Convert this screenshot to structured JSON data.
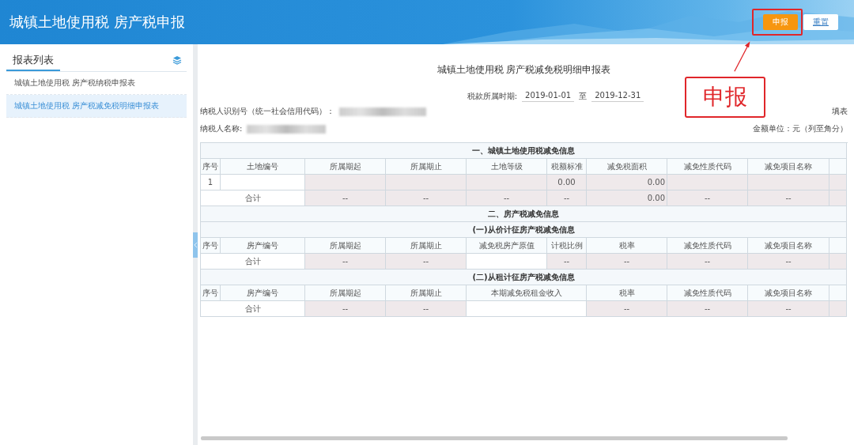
{
  "header": {
    "title": "城镇土地使用税 房产税申报",
    "buttons": [
      {
        "label": "申报",
        "kind": "primary"
      },
      {
        "label": "重置",
        "kind": "secondary"
      }
    ]
  },
  "callout": {
    "label": "申报"
  },
  "sidebar": {
    "title": "报表列表",
    "items": [
      {
        "label": "城镇土地使用税 房产税纳税申报表",
        "selected": false
      },
      {
        "label": "城镇土地使用税 房产税减免税明细申报表",
        "selected": true
      }
    ]
  },
  "form": {
    "title": "城镇土地使用税 房产税减免税明细申报表",
    "period": {
      "label": "税款所属时期:",
      "from": "2019-01-01",
      "separator": "至",
      "to": "2019-12-31"
    },
    "taxpayer_id": {
      "label": "纳税人识别号（统一社会信用代码）：",
      "redacted": true
    },
    "taxpayer_name": {
      "label": "纳税人名称:",
      "redacted": true
    },
    "fill_label": "填表",
    "unit": "金额单位：元（列至角分）",
    "rows": [
      {
        "kind": "section",
        "text": "一、城镇土地使用税减免信息"
      },
      {
        "kind": "header",
        "cells": [
          {
            "text": "序号",
            "kind": "plain"
          },
          {
            "text": "土地编号",
            "kind": "plain"
          },
          {
            "text": "所属期起",
            "kind": "plain"
          },
          {
            "text": "所属期止",
            "kind": "plain"
          },
          {
            "text": "土地等级",
            "kind": "plain"
          },
          {
            "text": "税额标准",
            "kind": "plain"
          },
          {
            "text": "减免税面积",
            "kind": "plain"
          },
          {
            "text": "减免性质代码",
            "kind": "plain"
          },
          {
            "text": "减免项目名称",
            "kind": "plain"
          },
          {
            "kind": "plain"
          }
        ]
      },
      {
        "kind": "data",
        "cells": [
          {
            "text": "1",
            "kind": "plain",
            "shaded": false
          },
          {
            "kind": "plain",
            "shaded": false
          },
          {
            "kind": "plain",
            "shaded": true
          },
          {
            "kind": "plain",
            "shaded": true
          },
          {
            "kind": "plain",
            "shaded": true
          },
          {
            "text": "0.00",
            "kind": "plain",
            "shaded": true
          },
          {
            "text": "0.00",
            "kind": "amount",
            "shaded": true
          },
          {
            "kind": "plain",
            "shaded": true
          },
          {
            "kind": "plain",
            "shaded": true
          },
          {
            "kind": "plain",
            "shaded": true
          }
        ]
      },
      {
        "kind": "data",
        "cells": [
          {
            "text": "合计",
            "kind": "merged",
            "shaded": false
          },
          {
            "text": "--",
            "kind": "plain",
            "shaded": true
          },
          {
            "text": "--",
            "kind": "plain",
            "shaded": true
          },
          {
            "text": "--",
            "kind": "plain",
            "shaded": true
          },
          {
            "text": "--",
            "kind": "plain",
            "shaded": true
          },
          {
            "text": "0.00",
            "kind": "amount",
            "shaded": true
          },
          {
            "text": "--",
            "kind": "plain",
            "shaded": true
          },
          {
            "text": "--",
            "kind": "plain",
            "shaded": true
          },
          {
            "kind": "plain",
            "shaded": true
          }
        ]
      },
      {
        "kind": "section",
        "text": "二、房产税减免信息"
      },
      {
        "kind": "section",
        "text": "(一)从价计征房产税减免信息"
      },
      {
        "kind": "header",
        "cells": [
          {
            "text": "序号",
            "kind": "plain"
          },
          {
            "text": "房产编号",
            "kind": "plain"
          },
          {
            "text": "所属期起",
            "kind": "plain"
          },
          {
            "text": "所属期止",
            "kind": "plain"
          },
          {
            "text": "减免税房产原值",
            "kind": "plain"
          },
          {
            "text": "计税比例",
            "kind": "plain"
          },
          {
            "text": "税率",
            "kind": "plain"
          },
          {
            "text": "减免性质代码",
            "kind": "plain"
          },
          {
            "text": "减免项目名称",
            "kind": "plain"
          },
          {
            "kind": "plain"
          }
        ]
      },
      {
        "kind": "data",
        "cells": [
          {
            "text": "合计",
            "kind": "merged",
            "shaded": false
          },
          {
            "text": "--",
            "kind": "plain",
            "shaded": true
          },
          {
            "text": "--",
            "kind": "plain",
            "shaded": true
          },
          {
            "kind": "plain",
            "shaded": false
          },
          {
            "text": "--",
            "kind": "plain",
            "shaded": true
          },
          {
            "text": "--",
            "kind": "plain",
            "shaded": true
          },
          {
            "text": "--",
            "kind": "plain",
            "shaded": true
          },
          {
            "text": "--",
            "kind": "plain",
            "shaded": true
          },
          {
            "kind": "plain",
            "shaded": true
          }
        ]
      },
      {
        "kind": "section",
        "text": "(二)从租计征房产税减免信息"
      },
      {
        "kind": "header",
        "cells": [
          {
            "text": "序号",
            "kind": "plain"
          },
          {
            "text": "房产编号",
            "kind": "plain"
          },
          {
            "text": "所属期起",
            "kind": "plain"
          },
          {
            "text": "所属期止",
            "kind": "plain"
          },
          {
            "text": "本期减免税租金收入",
            "kind": "merged"
          },
          {
            "text": "税率",
            "kind": "plain"
          },
          {
            "text": "减免性质代码",
            "kind": "plain"
          },
          {
            "text": "减免项目名称",
            "kind": "plain"
          },
          {
            "kind": "plain"
          }
        ]
      },
      {
        "kind": "data",
        "cells": [
          {
            "text": "合计",
            "kind": "merged",
            "shaded": false
          },
          {
            "text": "--",
            "kind": "plain",
            "shaded": true
          },
          {
            "text": "--",
            "kind": "plain",
            "shaded": true
          },
          {
            "kind": "merged",
            "shaded": false
          },
          {
            "text": "--",
            "kind": "plain",
            "shaded": true
          },
          {
            "text": "--",
            "kind": "plain",
            "shaded": true
          },
          {
            "text": "--",
            "kind": "plain",
            "shaded": true
          },
          {
            "kind": "plain",
            "shaded": true
          }
        ]
      }
    ]
  }
}
